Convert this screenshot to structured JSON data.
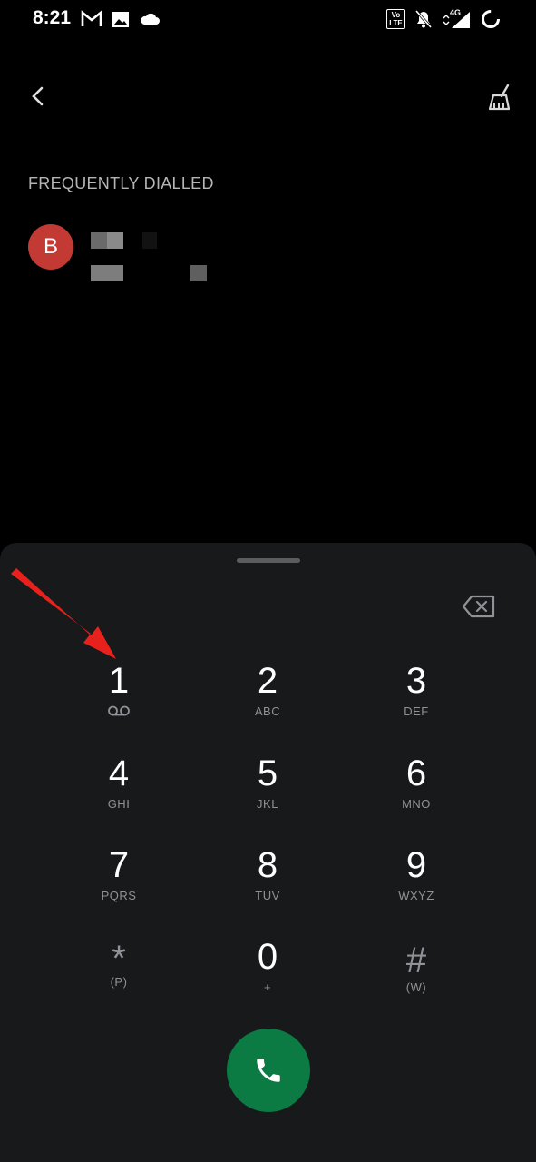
{
  "status_bar": {
    "time": "8:21",
    "network": "4G",
    "volte": "Vo LTE",
    "icons": [
      "gmail-icon",
      "image-icon",
      "cloud-icon",
      "volte-icon",
      "mute-icon",
      "signal-icon",
      "battery-icon"
    ]
  },
  "header": {
    "back_icon": "back-arrow-icon",
    "clear_icon": "broom-icon"
  },
  "frequently_dialled": {
    "title": "FREQUENTLY DIALLED",
    "contacts": [
      {
        "initial": "B",
        "avatar_color": "#c23a33"
      }
    ]
  },
  "dialpad": {
    "keys": [
      {
        "digit": "1",
        "letters": ""
      },
      {
        "digit": "2",
        "letters": "ABC"
      },
      {
        "digit": "3",
        "letters": "DEF"
      },
      {
        "digit": "4",
        "letters": "GHI"
      },
      {
        "digit": "5",
        "letters": "JKL"
      },
      {
        "digit": "6",
        "letters": "MNO"
      },
      {
        "digit": "7",
        "letters": "PQRS"
      },
      {
        "digit": "8",
        "letters": "TUV"
      },
      {
        "digit": "9",
        "letters": "WXYZ"
      },
      {
        "digit": "*",
        "letters": "(P)"
      },
      {
        "digit": "0",
        "letters": "+"
      },
      {
        "digit": "#",
        "letters": "(W)"
      }
    ],
    "voicemail_icon": "voicemail-icon",
    "backspace_icon": "backspace-icon",
    "call_icon": "phone-icon",
    "call_color": "#0b7a43"
  },
  "colors": {
    "background": "#000000",
    "sheet": "#17191b",
    "annotation": "#e8211c"
  }
}
